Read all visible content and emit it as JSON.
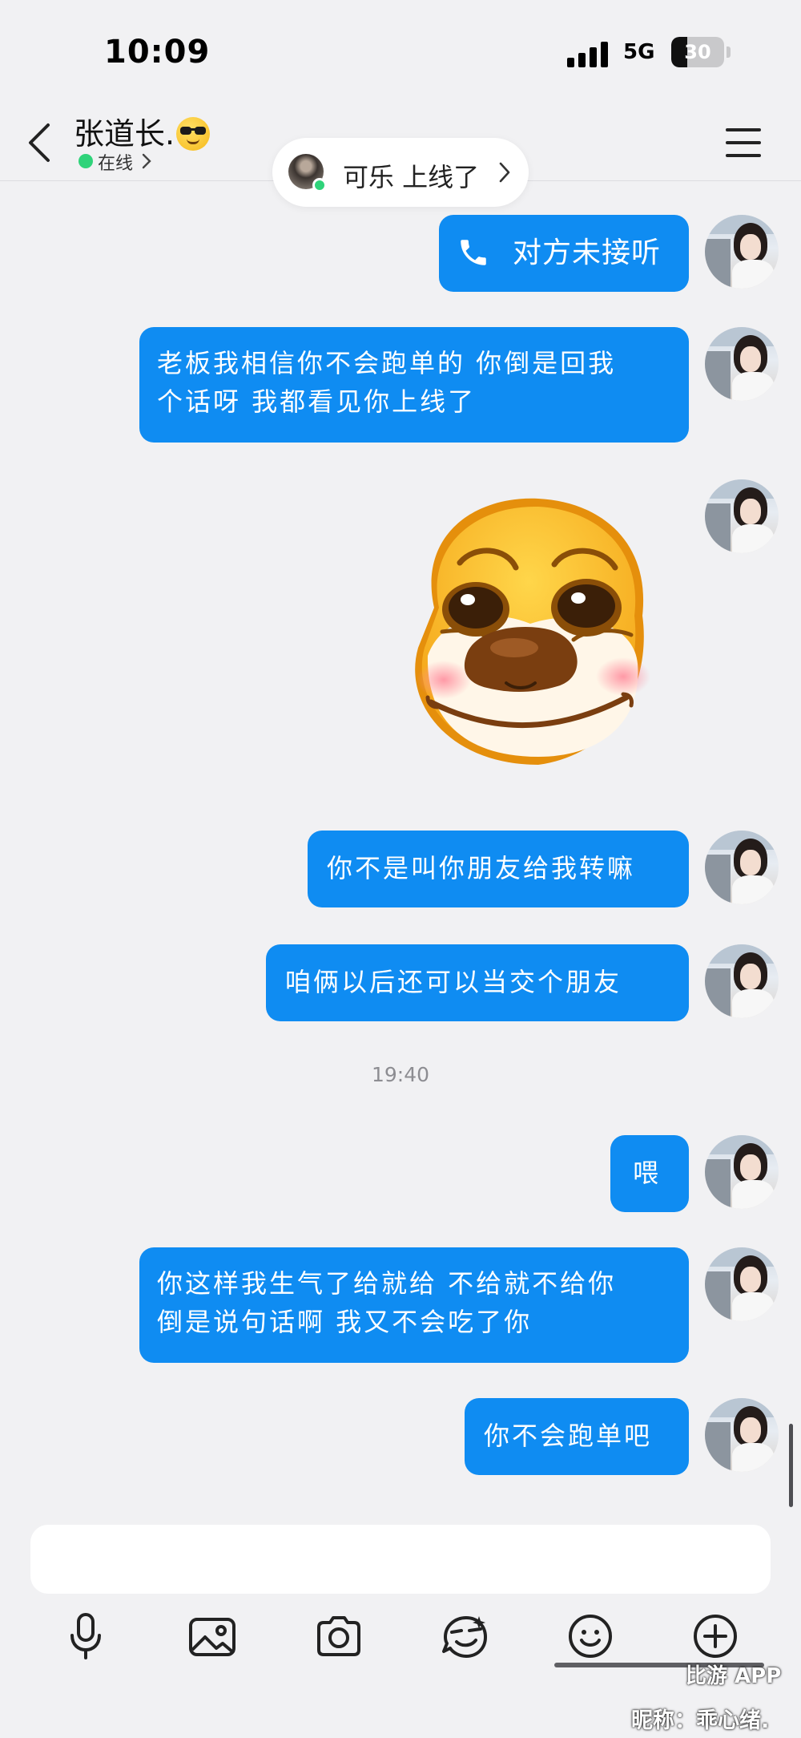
{
  "status_bar": {
    "time": "10:09",
    "network": "5G",
    "battery_level": "30",
    "battery_fraction": 0.3
  },
  "header": {
    "contact_name": "张道长.",
    "contact_emoji": "smiling-face-with-sunglasses-icon",
    "presence": "在线"
  },
  "toast": {
    "text": "可乐 上线了"
  },
  "messages": [
    {
      "type": "call",
      "text": "对方未接听",
      "icon": "phone-icon"
    },
    {
      "type": "text",
      "lines": [
        "老板我相信你不会跑单的 你倒是回我",
        "个话呀 我都看见你上线了"
      ]
    },
    {
      "type": "sticker",
      "icon": "dog-face-sticker"
    },
    {
      "type": "text",
      "lines": [
        "你不是叫你朋友给我转嘛"
      ]
    },
    {
      "type": "text",
      "lines": [
        "咱俩以后还可以当交个朋友"
      ]
    },
    {
      "type": "time",
      "text": "19:40"
    },
    {
      "type": "text",
      "lines": [
        "喂"
      ]
    },
    {
      "type": "text",
      "lines": [
        "你这样我生气了给就给 不给就不给你",
        "倒是说句话啊 我又不会吃了你"
      ]
    },
    {
      "type": "text",
      "lines": [
        "你不会跑单吧"
      ]
    }
  ],
  "composer": {
    "input_value": "",
    "toolbar": [
      "microphone-icon",
      "image-icon",
      "camera-icon",
      "sticker-face-icon",
      "smiley-icon",
      "plus-icon"
    ]
  },
  "watermark": {
    "app": "比游 APP",
    "nickname": "昵称：乖心绪."
  },
  "colors": {
    "bubble": "#0f8cf2",
    "background": "#f1f1f3",
    "online": "#2fd37a"
  }
}
